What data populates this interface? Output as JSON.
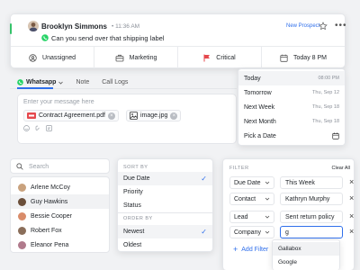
{
  "conversation": {
    "contact_name": "Brooklyn Simmons",
    "time": "11:36 AM",
    "message": "Can you send over that shipping label",
    "tag_label": "New Prospect",
    "more_glyph": "•••",
    "properties": [
      {
        "icon": "user-icon",
        "label": "Unassigned"
      },
      {
        "icon": "briefcase-icon",
        "label": "Marketing"
      },
      {
        "icon": "flag-icon",
        "label": "Critical",
        "color": "#e5484d"
      },
      {
        "icon": "calendar-icon",
        "label": "Today 8 PM"
      }
    ]
  },
  "compose": {
    "tabs": [
      "Whatsapp",
      "Note",
      "Call Logs"
    ],
    "placeholder": "Enter your message here",
    "attachments": [
      {
        "name": "Contract Agreement.pdf",
        "type": "pdf"
      },
      {
        "name": "image.jpg",
        "type": "image"
      }
    ]
  },
  "date_menu": {
    "options": [
      {
        "label": "Today",
        "value": "08:00 PM"
      },
      {
        "label": "Tomorrow",
        "value": "Thu, Sep 12"
      },
      {
        "label": "Next Week",
        "value": "Thu, Sep 18"
      },
      {
        "label": "Next Month",
        "value": "Thu, Sep 18"
      },
      {
        "label": "Pick a Date",
        "value": ""
      }
    ],
    "selected_index": 0
  },
  "contacts": {
    "search_placeholder": "Search",
    "items": [
      {
        "name": "Arlene McCoy",
        "avatar_color": "#c9a27e"
      },
      {
        "name": "Guy Hawkins",
        "avatar_color": "#6b4f3a"
      },
      {
        "name": "Bessie Cooper",
        "avatar_color": "#d98c6a"
      },
      {
        "name": "Robert Fox",
        "avatar_color": "#8a6e5a"
      },
      {
        "name": "Eleanor Pena",
        "avatar_color": "#b07a8c"
      }
    ],
    "selected_index": 1
  },
  "sort": {
    "sort_by_heading": "SORT BY",
    "sort_by": [
      "Due Date",
      "Priority",
      "Status"
    ],
    "sort_by_selected": 0,
    "order_by_heading": "ORDER BY",
    "order_by": [
      "Newest",
      "Oldest"
    ],
    "order_by_selected": 0
  },
  "filter": {
    "heading": "FILTER",
    "clear_label": "Clear All",
    "rows": [
      {
        "field": "Due Date",
        "value": "This Week"
      },
      {
        "field": "Contact",
        "value": "Kathryn Murphy"
      },
      {
        "field": "Lead",
        "value": "Sent return policy"
      },
      {
        "field": "Company",
        "value": "g"
      }
    ],
    "add_label": "Add Filter",
    "suggestions": [
      "Gallabox",
      "Google"
    ],
    "suggestion_selected": 0
  },
  "colors": {
    "accent": "#2f6feb",
    "whatsapp": "#25d366",
    "critical": "#e5484d"
  }
}
